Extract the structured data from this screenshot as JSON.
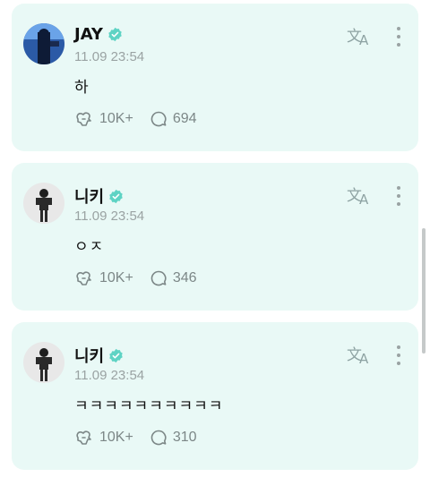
{
  "posts": [
    {
      "author": "JAY",
      "time": "11.09 23:54",
      "text": "하",
      "likes": "10K+",
      "comments": "694",
      "avatar_icon": "avatar-jay",
      "accent": "#5ed3c4"
    },
    {
      "author": "니키",
      "time": "11.09 23:54",
      "text": "ㅇㅈ",
      "likes": "10K+",
      "comments": "346",
      "avatar_icon": "avatar-niki",
      "accent": "#5ed3c4"
    },
    {
      "author": "니키",
      "time": "11.09 23:54",
      "text": "ㅋㅋㅋㅋㅋㅋㅋㅋㅋㅋ",
      "likes": "10K+",
      "comments": "310",
      "avatar_icon": "avatar-niki",
      "accent": "#5ed3c4"
    }
  ],
  "icons": {
    "verified": "verified-badge-icon",
    "translate": "translate-icon",
    "more": "more-options-icon",
    "like": "like-icon",
    "comment": "comment-icon"
  },
  "colors": {
    "card_bg": "#e9f9f6",
    "verified": "#5ed3c4",
    "muted": "#9aa3a3"
  }
}
